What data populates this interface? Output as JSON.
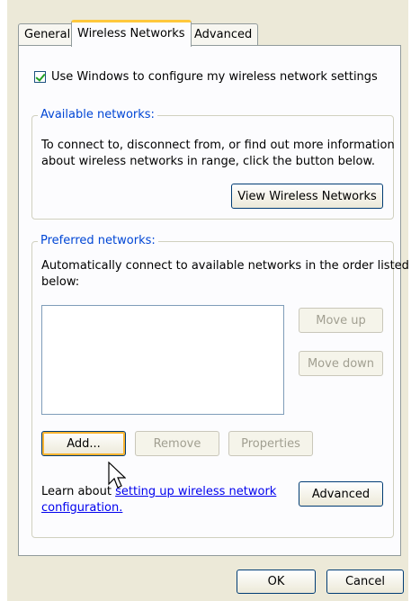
{
  "tabs": {
    "general": "General",
    "wireless": "Wireless Networks",
    "advanced": "Advanced"
  },
  "use_windows_checkbox": {
    "label": "Use Windows to configure my wireless network settings",
    "checked": true
  },
  "available": {
    "legend": "Available networks:",
    "description_line1": "To connect to, disconnect from, or find out more information",
    "description_line2": "about wireless networks in range, click the button below.",
    "view_button": "View Wireless Networks"
  },
  "preferred": {
    "legend": "Preferred networks:",
    "description_line1": "Automatically connect to available networks in the order listed",
    "description_line2": "below:",
    "move_up": "Move up",
    "move_down": "Move down",
    "add": "Add...",
    "remove": "Remove",
    "properties": "Properties",
    "learn_prefix": "Learn about ",
    "learn_link_line1": "setting up wireless network",
    "learn_link_line2": "configuration.",
    "advanced_button": "Advanced"
  },
  "footer": {
    "ok": "OK",
    "cancel": "Cancel"
  },
  "colors": {
    "accent_tab": "#ffc83c",
    "legend_blue": "#0046d5",
    "link_blue": "#0000ee",
    "dialog_bg": "#ece9d8"
  },
  "cursor_icon": "arrow-pointer-icon"
}
